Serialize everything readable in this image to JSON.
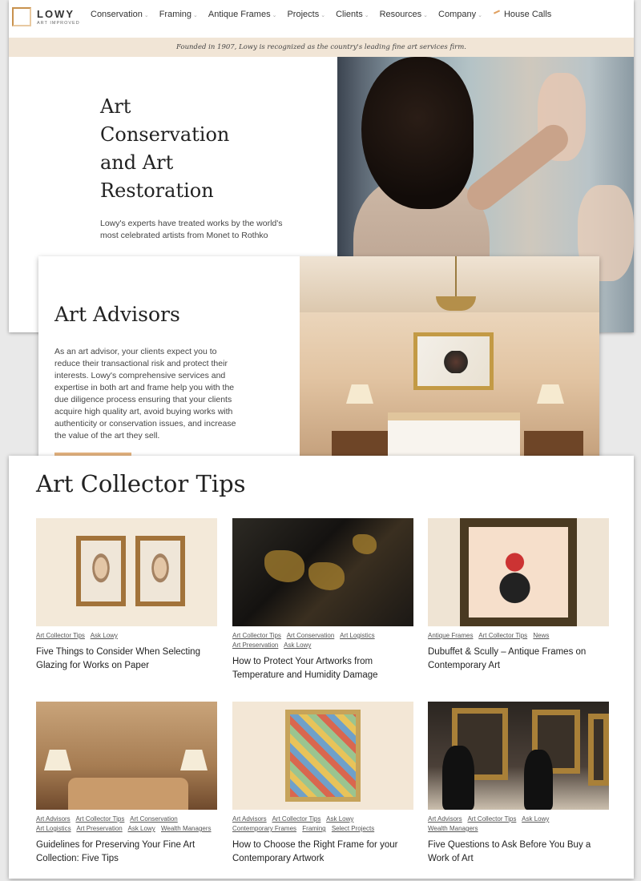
{
  "logo": {
    "name": "LOWY",
    "tagline": "ART IMPROVED"
  },
  "nav": {
    "items": [
      {
        "label": "Conservation",
        "chevron": "⌄"
      },
      {
        "label": "Framing",
        "chevron": "⌄"
      },
      {
        "label": "Antique Frames",
        "chevron": "⌄"
      },
      {
        "label": "Projects",
        "chevron": "⌄"
      },
      {
        "label": "Clients",
        "chevron": "⌄"
      },
      {
        "label": "Resources",
        "chevron": "⌄"
      },
      {
        "label": "Company",
        "chevron": "⌄"
      }
    ],
    "house_calls": "House Calls"
  },
  "banner": "Founded in 1907, Lowy is recognized as the country's leading fine art services firm.",
  "hero": {
    "title": "Art Conservation and Art Restoration",
    "text": "Lowy's experts have treated works by the world's most celebrated artists from Monet to Rothko"
  },
  "advisors": {
    "title": "Art Advisors",
    "text": "As an art advisor, your clients expect you to reduce their transactional risk and protect their interests. Lowy's comprehensive services and expertise in both art and frame help you with the due diligence process ensuring that your clients acquire high quality art, avoid buying works with authenticity or conservation issues, and increase the value of the art they sell."
  },
  "tips": {
    "title": "Art Collector Tips",
    "cards": [
      {
        "tags": [
          "Art Collector Tips",
          "Ask Lowy"
        ],
        "title": "Five Things to Consider When Selecting Glazing for Works on Paper"
      },
      {
        "tags": [
          "Art Collector Tips",
          "Art Conservation",
          "Art Logistics",
          "Art Preservation",
          "Ask Lowy"
        ],
        "title": "How to Protect Your Artworks from Temperature and Humidity Damage"
      },
      {
        "tags": [
          "Antique Frames",
          "Art Collector Tips",
          "News"
        ],
        "title": "Dubuffet & Scully – Antique Frames on Contemporary Art"
      },
      {
        "tags": [
          "Art Advisors",
          "Art Collector Tips",
          "Art Conservation",
          "Art Logistics",
          "Art Preservation",
          "Ask Lowy",
          "Wealth Managers"
        ],
        "title": "Guidelines for Preserving Your Fine Art Collection: Five Tips"
      },
      {
        "tags": [
          "Art Advisors",
          "Art Collector Tips",
          "Ask Lowy",
          "Contemporary Frames",
          "Framing",
          "Select Projects"
        ],
        "title": "How to Choose the Right Frame for your Contemporary Artwork"
      },
      {
        "tags": [
          "Art Advisors",
          "Art Collector Tips",
          "Ask Lowy",
          "Wealth Managers"
        ],
        "title": "Five Questions to Ask Before You Buy a Work of Art"
      }
    ]
  }
}
